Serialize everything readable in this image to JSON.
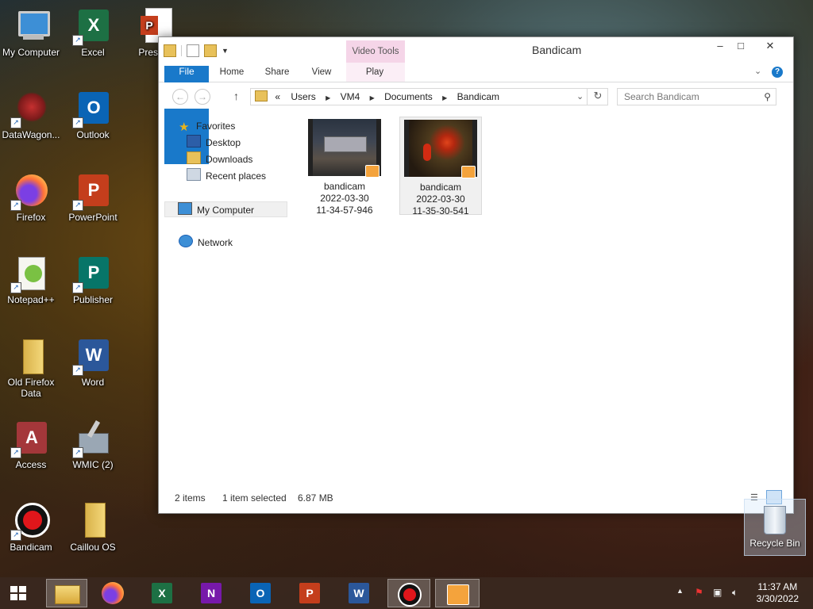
{
  "desktop": {
    "icons": [
      {
        "label": "My Computer"
      },
      {
        "label": "Excel"
      },
      {
        "label": "Present"
      },
      {
        "label": "DataWagon..."
      },
      {
        "label": "Outlook"
      },
      {
        "label": "Firefox"
      },
      {
        "label": "PowerPoint"
      },
      {
        "label": "Notepad++"
      },
      {
        "label": "Publisher"
      },
      {
        "label": "Old Firefox Data"
      },
      {
        "label": "Word"
      },
      {
        "label": "Access"
      },
      {
        "label": "WMIC (2)"
      },
      {
        "label": "Bandicam"
      },
      {
        "label": "Caillou OS"
      }
    ],
    "recycle_bin": "Recycle Bin"
  },
  "window": {
    "title": "Bandicam",
    "context_tab": "Video Tools",
    "ribbon_tabs": {
      "file": "File",
      "home": "Home",
      "share": "Share",
      "view": "View",
      "play": "Play"
    },
    "address": {
      "overflow": "«",
      "crumbs": [
        "Users",
        "VM4",
        "Documents",
        "Bandicam"
      ]
    },
    "search_placeholder": "Search Bandicam",
    "nav": {
      "favorites": "Favorites",
      "desktop": "Desktop",
      "downloads": "Downloads",
      "recent": "Recent places",
      "my_computer": "My Computer",
      "network": "Network"
    },
    "files": [
      {
        "name": "bandicam",
        "line2": "2022-03-30",
        "line3": "11-34-57-946"
      },
      {
        "name": "bandicam",
        "line2": "2022-03-30",
        "line3": "11-35-30-541"
      }
    ],
    "status": {
      "items": "2 items",
      "selected": "1 item selected",
      "size": "6.87 MB"
    }
  },
  "taskbar": {
    "time": "11:37 AM",
    "date": "3/30/2022"
  },
  "colors": {
    "accent": "#1979ca",
    "context_tab": "#f5d5e8"
  }
}
